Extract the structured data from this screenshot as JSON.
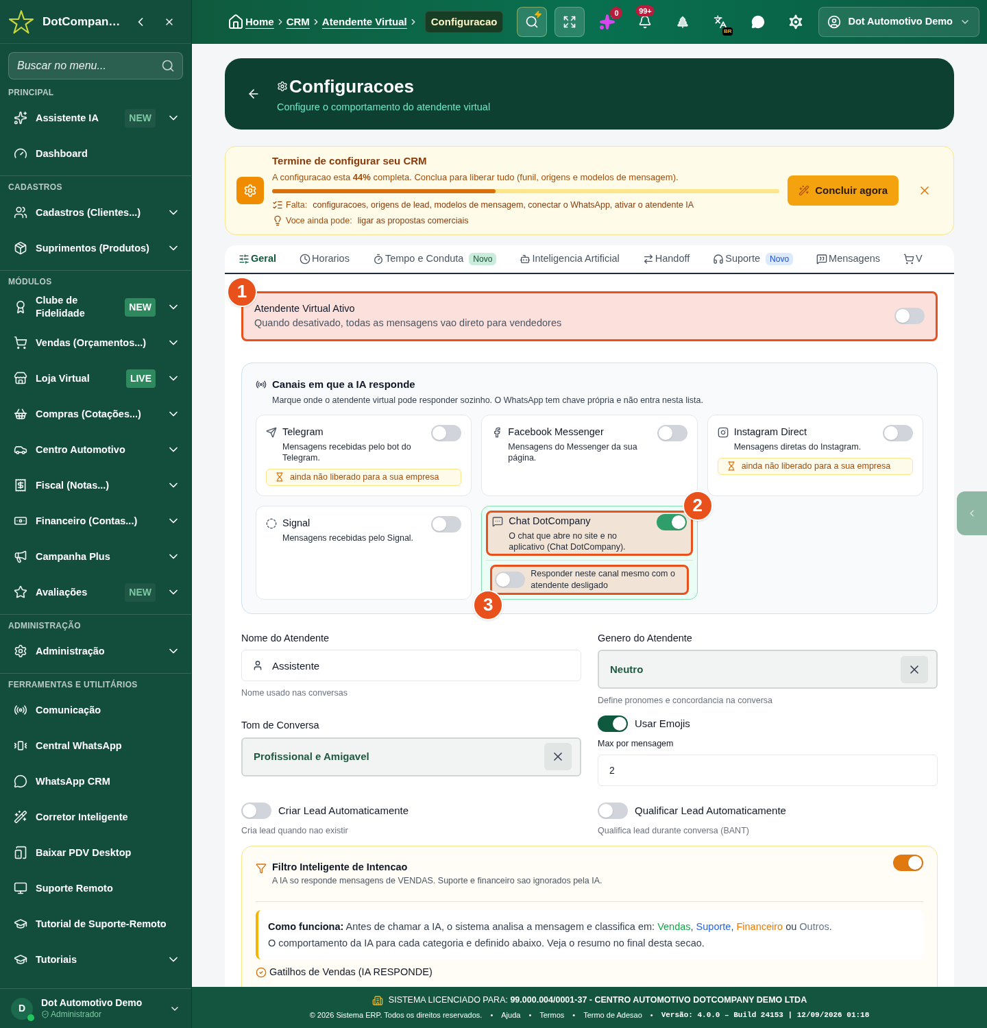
{
  "sidebar": {
    "brand": "DotCompan…",
    "search": {
      "placeholder": "Buscar no menu..."
    },
    "sections": [
      {
        "title": "PRINCIPAL",
        "items": [
          {
            "label": "Assistente IA",
            "badge": {
              "text": "NEW",
              "kind": "dim"
            },
            "submenu": true
          },
          {
            "label": "Dashboard",
            "submenu": false
          }
        ]
      },
      {
        "title": "CADASTROS",
        "items": [
          {
            "label": "Cadastros (Clientes...)",
            "submenu": true
          },
          {
            "label": "Suprimentos (Produtos)",
            "submenu": true
          }
        ]
      },
      {
        "title": "MÓDULOS",
        "items": [
          {
            "label": "Clube de Fidelidade",
            "badge": {
              "text": "NEW",
              "kind": "solid"
            },
            "submenu": true
          },
          {
            "label": "Vendas (Orçamentos...)",
            "submenu": true
          },
          {
            "label": "Loja Virtual",
            "badge": {
              "text": "LIVE",
              "kind": "solid"
            },
            "submenu": true
          },
          {
            "label": "Compras (Cotações...)",
            "submenu": true
          },
          {
            "label": "Centro Automotivo",
            "submenu": true
          },
          {
            "label": "Fiscal (Notas...)",
            "submenu": true
          },
          {
            "label": "Financeiro (Contas...)",
            "submenu": true
          },
          {
            "label": "Campanha Plus",
            "submenu": true
          },
          {
            "label": "Avaliações",
            "badge": {
              "text": "NEW",
              "kind": "dim"
            },
            "submenu": true
          }
        ]
      },
      {
        "title": "ADMINISTRAÇÃO",
        "items": [
          {
            "label": "Administração",
            "submenu": true
          }
        ]
      },
      {
        "title": "FERRAMENTAS E UTILITÁRIOS",
        "items": [
          {
            "label": "Comunicação",
            "submenu": false
          },
          {
            "label": "Central WhatsApp",
            "submenu": false
          },
          {
            "label": "WhatsApp CRM",
            "submenu": false
          },
          {
            "label": "Corretor Inteligente",
            "submenu": false
          },
          {
            "label": "Baixar PDV Desktop",
            "submenu": false
          },
          {
            "label": "Suporte Remoto",
            "submenu": false
          },
          {
            "label": "Tutorial de Suporte-Remoto",
            "submenu": false
          },
          {
            "label": "Tutoriais",
            "submenu": true
          }
        ]
      }
    ],
    "user": {
      "initial": "D",
      "name": "Dot Automotivo Demo",
      "role": "Administrador",
      "online": true
    }
  },
  "header": {
    "breadcrumb": [
      "Home",
      "CRM",
      "Atendente Virtual"
    ],
    "current": "Configuracao",
    "ai_count": "0",
    "notifications": "99+",
    "language": "BR",
    "user": "Dot Automotivo Demo"
  },
  "page": {
    "title": "Configuracoes",
    "subtitle": "Configure o comportamento do atendente virtual"
  },
  "setup_banner": {
    "title": "Termine de configurar seu CRM",
    "text": "A configuracao esta **44%** completa. Conclua para liberar tudo (funil, origens e modelos de mensagem).",
    "level": 0.44,
    "missing_label": "Falta:",
    "missing": "configuracoes, origens de lead, modelos de mensagem, conectar o WhatsApp, ativar o atendente IA",
    "optional_label": "Voce ainda pode:",
    "optional": "ligar as propostas comerciais",
    "button": "Concluir agora"
  },
  "tabs": [
    {
      "label": "Geral",
      "selected": true
    },
    {
      "label": "Horarios",
      "selected": false
    },
    {
      "label": "Tempo e Conduta",
      "selected": false,
      "badge": {
        "text": "Novo",
        "kind": "success"
      }
    },
    {
      "label": "Inteligencia Artificial",
      "selected": false
    },
    {
      "label": "Handoff",
      "selected": false
    },
    {
      "label": "Suporte",
      "selected": false,
      "badge": {
        "text": "Novo",
        "kind": "info"
      }
    },
    {
      "label": "Mensagens",
      "selected": false
    },
    {
      "label": "V",
      "selected": false
    }
  ],
  "agent_toggle": {
    "title": "Atendente Virtual Ativo",
    "description": "Quando desativado, todas as mensagens vao direto para vendedores",
    "on": false,
    "marker": "1"
  },
  "channels": {
    "title": "Canais em que a IA responde",
    "description": "Marque onde o atendente virtual pode responder sozinho. O WhatsApp tem chave própria e não entra nesta lista.",
    "items": [
      {
        "name": "Telegram",
        "description": "Mensagens recebidas pelo bot do Telegram.",
        "on": false,
        "note": "ainda não liberado para a sua empresa"
      },
      {
        "name": "Facebook Messenger",
        "description": "Mensagens do Messenger da sua página.",
        "on": false
      },
      {
        "name": "Instagram Direct",
        "description": "Mensagens diretas do Instagram.",
        "on": false,
        "note": "ainda não liberado para a sua empresa"
      },
      {
        "name": "Signal",
        "description": "Mensagens recebidas pelo Signal.",
        "on": false
      },
      {
        "name": "Chat DotCompany",
        "description": "O chat que abre no site e no aplicativo (Chat DotCompany).",
        "on": true,
        "marker": "2",
        "option": {
          "label": "Responder neste canal mesmo com o atendente desligado",
          "on": false,
          "marker": "3"
        }
      }
    ]
  },
  "form": {
    "agent_name": {
      "label": "Nome do Atendente",
      "value": "Assistente",
      "help": "Nome usado nas conversas"
    },
    "gender": {
      "label": "Genero do Atendente",
      "value": "Neutro",
      "help": "Define pronomes e concordancia na conversa"
    },
    "tone": {
      "label": "Tom de Conversa",
      "value": "Profissional e Amigavel"
    },
    "emojis": {
      "label": "Usar Emojis",
      "on": true
    },
    "max_emojis": {
      "label": "Max por mensagem",
      "value": "2"
    },
    "auto_lead": {
      "label": "Criar Lead Automaticamente",
      "on": false,
      "help": "Cria lead quando nao existir"
    },
    "qualify_lead": {
      "label": "Qualificar Lead Automaticamente",
      "on": false,
      "help": "Qualifica lead durante conversa (BANT)"
    }
  },
  "intent_filter": {
    "title": "Filtro Inteligente de Intencao",
    "description": "A IA so responde mensagens de VENDAS. Suporte e financeiro sao ignorados pela IA.",
    "on": true,
    "info": {
      "lead": "Como funciona:",
      "text": " Antes de chamar a IA, o sistema analisa a mensagem e classifica em: ",
      "categories": [
        {
          "label": "Vendas",
          "color": "#16a34a",
          "after": ", "
        },
        {
          "label": "Suporte",
          "color": "#2563eb",
          "after": ", "
        },
        {
          "label": "Financeiro",
          "color": "#ea7a0c",
          "after": " ou "
        },
        {
          "label": "Outros",
          "color": "#64748b",
          "after": "."
        }
      ],
      "note": "O comportamento da IA para cada categoria e definido abaixo. Veja o resumo no final desta secao."
    },
    "triggers_title": "Gatilhos de Vendas (IA RESPONDE)"
  },
  "footer": {
    "license": "SISTEMA LICENCIADO PARA: **99.000.004/0001-37 - CENTRO AUTOMOTIVO DOTCOMPANY DEMO LTDA**",
    "copyright": "© 2026 Sistema ERP. Todos os direitos reservados.",
    "separator": "•",
    "links": [
      "Ajuda",
      "Termos",
      "Termo de Adesao"
    ],
    "version": "Versão: 4.0.0 – Build 24153 | 12/09/2026 01:18"
  }
}
